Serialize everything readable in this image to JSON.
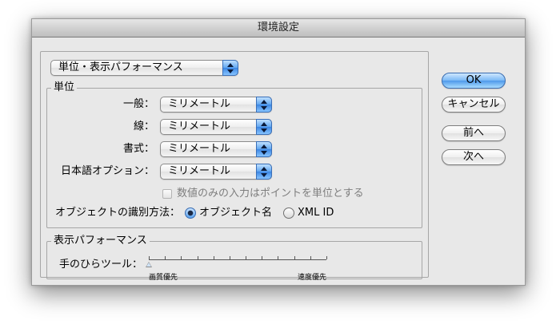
{
  "window": {
    "title": "環境設定"
  },
  "section_popup": {
    "value": "単位・表示パフォーマンス"
  },
  "units": {
    "group_title": "単位",
    "rows": [
      {
        "label": "一般：",
        "value": "ミリメートル"
      },
      {
        "label": "線：",
        "value": "ミリメートル"
      },
      {
        "label": "書式：",
        "value": "ミリメートル"
      },
      {
        "label": "日本語オプション：",
        "value": "ミリメートル"
      }
    ],
    "checkbox_label": "数値のみの入力はポイントを単位とする",
    "checkbox_checked": false,
    "object_id_label": "オブジェクトの識別方法：",
    "radio_options": [
      {
        "label": "オブジェクト名",
        "selected": true
      },
      {
        "label": "XML ID",
        "selected": false
      }
    ]
  },
  "display_performance": {
    "group_title": "表示パフォーマンス",
    "slider_label": "手のひらツール：",
    "slider_value_fraction": 0,
    "slider_tick_count": 12,
    "slider_min_label": "画質優先",
    "slider_max_label": "速度優先"
  },
  "buttons": {
    "ok": "OK",
    "cancel": "キャンセル",
    "previous": "前へ",
    "next": "次へ"
  }
}
